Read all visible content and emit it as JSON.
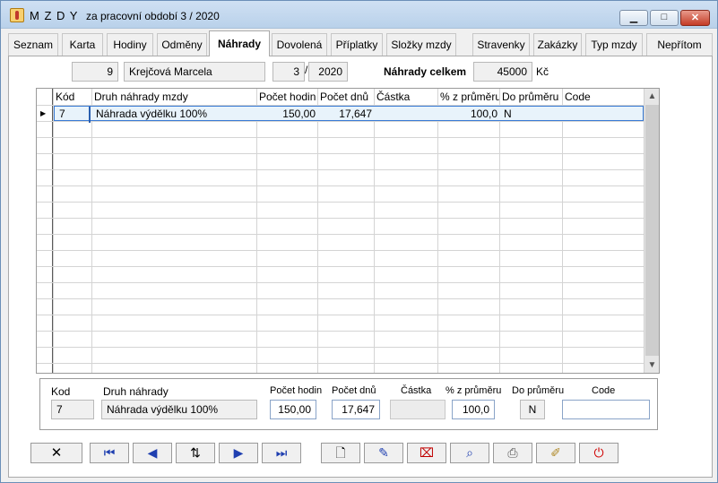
{
  "window": {
    "app_title": "M Z D Y",
    "subtitle": "za pracovní období  3 / 2020",
    "minimize_glyph": "▁",
    "maximize_glyph": "□",
    "close_glyph": "✕"
  },
  "tabs": [
    {
      "label": "Seznam"
    },
    {
      "label": "Karta"
    },
    {
      "label": "Hodiny"
    },
    {
      "label": "Odměny"
    },
    {
      "label": "Náhrady"
    },
    {
      "label": "Dovolená"
    },
    {
      "label": "Příplatky"
    },
    {
      "label": "Složky mzdy"
    },
    {
      "label": "Stravenky"
    },
    {
      "label": "Zakázky"
    },
    {
      "label": "Typ mzdy"
    },
    {
      "label": "Nepřítom"
    }
  ],
  "active_tab": "Náhrady",
  "header": {
    "employee_no": "9",
    "employee_name": "Krejčová Marcela",
    "month": "3",
    "separator": "/",
    "year": "2020",
    "total_label": "Náhrady celkem",
    "total_value": "45000",
    "currency": "Kč"
  },
  "grid": {
    "columns": [
      "Kód",
      "Druh náhrady mzdy",
      "Počet hodin",
      "Počet dnů",
      "Částka",
      "% z průměru",
      "Do průměru",
      "Code"
    ],
    "rows": [
      {
        "kod": "7",
        "druh": "Náhrada výdělku 100%",
        "hodin": "150,00",
        "dnu": "17,647",
        "castka": "",
        "procento": "100,0",
        "do_prumeru": "N",
        "code": ""
      }
    ],
    "scroll_up": "▲",
    "scroll_down": "▼"
  },
  "detail": {
    "kod_label": "Kod",
    "kod_value": "7",
    "druh_label": "Druh náhrady",
    "druh_value": "Náhrada výdělku 100%",
    "hodin_label": "Počet hodin",
    "hodin_value": "150,00",
    "dnu_label": "Počet dnů",
    "dnu_value": "17,647",
    "castka_label": "Částka",
    "castka_value": "",
    "procento_label": "% z průměru",
    "procento_value": "100,0",
    "do_prumeru_label": "Do průměru",
    "do_prumeru_value": "N",
    "code_label": "Code",
    "code_value": ""
  },
  "toolbar": {
    "cancel": "✕",
    "first": "⏮",
    "prev": "◀",
    "sort": "⇅",
    "next": "▶",
    "last": "⏭",
    "new": "🗋",
    "edit": "✎",
    "delete": "⌧",
    "find": "⌕",
    "print": "⎙",
    "clear": "✐",
    "power": "⏻"
  },
  "colors": {
    "selection_border": "#3a7bd5",
    "selection_fill": "#e8f3fb",
    "close_red": "#c43b26",
    "power_red": "#d00000",
    "nav_blue": "#1f3fb0"
  }
}
